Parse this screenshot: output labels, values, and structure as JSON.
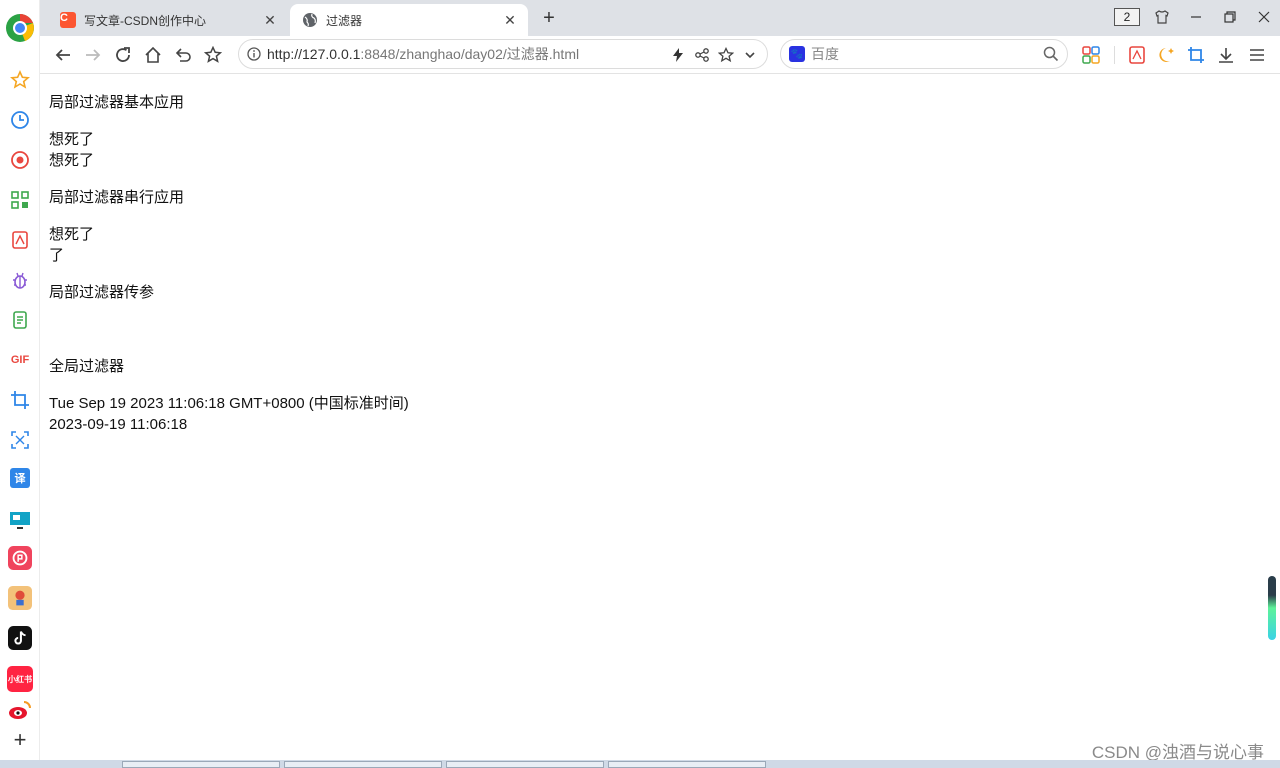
{
  "browser": {
    "tabs": [
      {
        "label": "写文章-CSDN创作中心",
        "icon": "csdn-icon",
        "active": false
      },
      {
        "label": "过滤器",
        "icon": "globe-icon",
        "active": true
      }
    ],
    "new_tab_label": "+",
    "tab_count": "2",
    "address": {
      "host": "http://127.0.0.1",
      "rest": ":8848/zhanghao/day02/过滤器.html"
    },
    "search": {
      "placeholder": "百度"
    }
  },
  "page": {
    "sections": [
      {
        "heading": "局部过滤器基本应用",
        "lines": [
          "想死了",
          "想死了"
        ]
      },
      {
        "heading": "局部过滤器串行应用",
        "lines": [
          "想死了",
          "了"
        ]
      },
      {
        "heading": "局部过滤器传参",
        "lines": []
      },
      {
        "heading": "全局过滤器",
        "lines": [
          "Tue Sep 19 2023 11:06:18 GMT+0800 (中国标准时间)",
          "2023-09-19 11:06:18"
        ]
      }
    ]
  },
  "sidebar": {
    "gif_label": "GIF",
    "translate_label": "译",
    "xhs_label": "小红书"
  },
  "watermark": "CSDN @浊酒与说心事",
  "colors": {
    "accent": "#1a73e8",
    "csdn": "#fc5531",
    "titlebar": "#dee1e6"
  }
}
